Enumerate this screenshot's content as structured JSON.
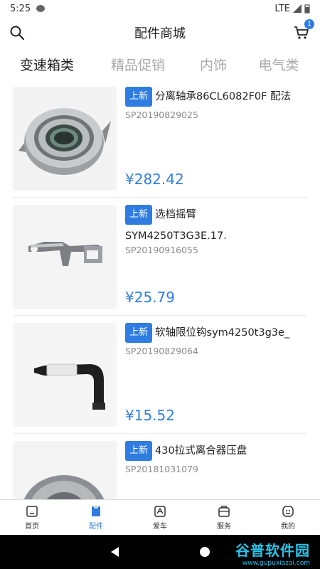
{
  "status": {
    "time": "5:25",
    "network": "LTE"
  },
  "header": {
    "title": "配件商城",
    "cart_count": "1"
  },
  "tabs": [
    {
      "label": "变速箱类",
      "active": true
    },
    {
      "label": "精品促销",
      "active": false
    },
    {
      "label": "内饰",
      "active": false
    },
    {
      "label": "电气类",
      "active": false
    }
  ],
  "products": [
    {
      "tag": "上新",
      "name": "分离轴承86CL6082F0F 配法",
      "name_cont": "",
      "code": "SP20190829025",
      "price": "¥282.42"
    },
    {
      "tag": "上新",
      "name": "选档摇臂",
      "name_cont": "SYM4250T3G3E.17.",
      "code": "SP20190916055",
      "price": "¥25.79"
    },
    {
      "tag": "上新",
      "name": "软轴限位钩sym4250t3g3e_",
      "name_cont": "",
      "code": "SP20190829064",
      "price": "¥15.52"
    },
    {
      "tag": "上新",
      "name": "430拉式离合器压盘",
      "name_cont": "",
      "code": "SP20181031079",
      "price": ""
    }
  ],
  "bottom_nav": [
    {
      "label": "首页",
      "icon": "home-icon",
      "active": false
    },
    {
      "label": "配件",
      "icon": "parts-icon",
      "active": true
    },
    {
      "label": "爱车",
      "icon": "car-icon",
      "active": false
    },
    {
      "label": "服务",
      "icon": "service-icon",
      "active": false
    },
    {
      "label": "我的",
      "icon": "profile-icon",
      "active": false
    }
  ],
  "watermark": {
    "main": "谷普软件园",
    "url": "www.gupuxiazai.com"
  },
  "colors": {
    "accent": "#2f7de1",
    "tab_inactive": "#a9a9a9"
  }
}
